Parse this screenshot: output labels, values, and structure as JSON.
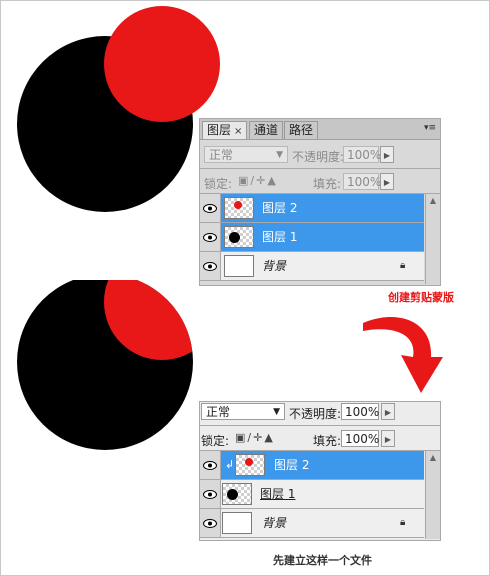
{
  "colors": {
    "red": "#e81718",
    "black": "#000000",
    "selection_blue": "#3d97ea",
    "annotation_red": "#e81718"
  },
  "panel1": {
    "tabs": [
      {
        "label": "图层",
        "close": "×"
      },
      {
        "label": "通道"
      },
      {
        "label": "路径"
      }
    ],
    "menu_icon": "panel-menu-icon",
    "blend_mode": "正常",
    "opacity_label": "不透明度:",
    "opacity_value": "100%",
    "lock_label": "锁定:",
    "fill_label": "填充:",
    "fill_value": "100%",
    "layers": [
      {
        "name": "图层 2",
        "selected": true,
        "thumb": "red-dot"
      },
      {
        "name": "图层 1",
        "selected": true,
        "thumb": "black-dot"
      },
      {
        "name": "背景",
        "selected": false,
        "thumb": "white",
        "locked": true
      }
    ]
  },
  "annotation": {
    "text": "创建剪贴蒙版"
  },
  "panel2": {
    "blend_mode": "正常",
    "opacity_label": "不透明度:",
    "opacity_value": "100%",
    "lock_label": "锁定:",
    "fill_label": "填充:",
    "fill_value": "100%",
    "layers": [
      {
        "name": "图层 2",
        "selected": true,
        "thumb": "red-dot",
        "clipped": true
      },
      {
        "name": "图层 1",
        "selected": false,
        "thumb": "black-dot",
        "underlined": true
      },
      {
        "name": "背景",
        "selected": false,
        "thumb": "white",
        "locked": true
      }
    ]
  },
  "caption": "先建立这样一个文件"
}
